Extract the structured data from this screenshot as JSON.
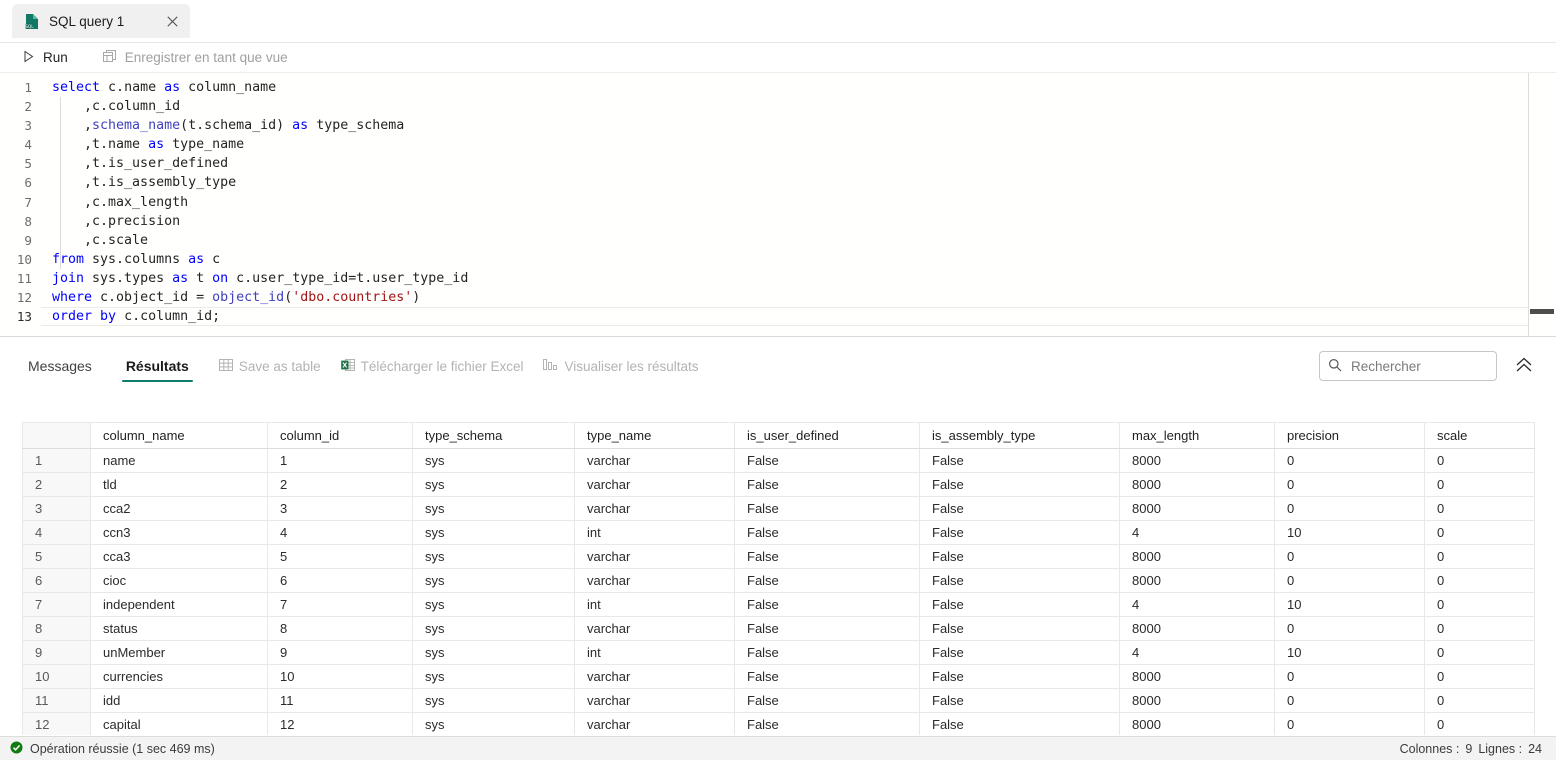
{
  "tab": {
    "title": "SQL query 1",
    "icon": "sql-file-icon",
    "close_icon": "close-icon"
  },
  "query_toolbar": {
    "run_label": "Run",
    "run_icon": "play-icon",
    "save_as_view_label": "Enregistrer en tant que vue",
    "save_as_view_icon": "save-view-icon"
  },
  "editor": {
    "lines": [
      {
        "n": "1",
        "html": "<span class=\"kw\">select</span> c.name <span class=\"kw\">as</span> column_name"
      },
      {
        "n": "2",
        "html": "    ,c.column_id"
      },
      {
        "n": "3",
        "html": "    ,<span class=\"fn\">schema_name</span>(t.schema_id) <span class=\"kw\">as</span> type_schema"
      },
      {
        "n": "4",
        "html": "    ,t.name <span class=\"kw\">as</span> type_name"
      },
      {
        "n": "5",
        "html": "    ,t.is_user_defined"
      },
      {
        "n": "6",
        "html": "    ,t.is_assembly_type"
      },
      {
        "n": "7",
        "html": "    ,c.max_length"
      },
      {
        "n": "8",
        "html": "    ,c.precision"
      },
      {
        "n": "9",
        "html": "    ,c.scale"
      },
      {
        "n": "10",
        "html": "<span class=\"kw\">from</span> sys.columns <span class=\"kw\">as</span> c"
      },
      {
        "n": "11",
        "html": "<span class=\"kw\">join</span> sys.types <span class=\"kw\">as</span> t <span class=\"kw\">on</span> c.user_type_id=t.user_type_id"
      },
      {
        "n": "12",
        "html": "<span class=\"kw\">where</span> c.object_id = <span class=\"fn\">object_id</span>(<span class=\"str\">'dbo.countries'</span>)"
      },
      {
        "n": "13",
        "html": "<span class=\"kw\">order</span> <span class=\"kw\">by</span> c.column_id;",
        "current": true
      }
    ],
    "plain_text": "select c.name as column_name\n    ,c.column_id\n    ,schema_name(t.schema_id) as type_schema\n    ,t.name as type_name\n    ,t.is_user_defined\n    ,t.is_assembly_type\n    ,c.max_length\n    ,c.precision\n    ,c.scale\nfrom sys.columns as c\njoin sys.types as t on c.user_type_id=t.user_type_id\nwhere c.object_id = object_id('dbo.countries')\norder by c.column_id;"
  },
  "results_toolbar": {
    "tabs": [
      {
        "label": "Messages",
        "active": false
      },
      {
        "label": "Résultats",
        "active": true
      }
    ],
    "actions": [
      {
        "label": "Save as table",
        "icon": "table-grid-icon",
        "enabled": false
      },
      {
        "label": "Télécharger le fichier Excel",
        "icon": "excel-icon",
        "enabled": false
      },
      {
        "label": "Visualiser les résultats",
        "icon": "bar-chart-icon",
        "enabled": false
      }
    ],
    "search": {
      "placeholder": "Rechercher",
      "value": "",
      "icon": "search-icon"
    },
    "collapse_icon": "double-chevron-up-icon",
    "active_tab_accent": "#107c6e"
  },
  "results_grid": {
    "columns": [
      "column_name",
      "column_id",
      "type_schema",
      "type_name",
      "is_user_defined",
      "is_assembly_type",
      "max_length",
      "precision",
      "scale"
    ],
    "rows": [
      {
        "num": "1",
        "cells": [
          "name",
          "1",
          "sys",
          "varchar",
          "False",
          "False",
          "8000",
          "0",
          "0"
        ]
      },
      {
        "num": "2",
        "cells": [
          "tld",
          "2",
          "sys",
          "varchar",
          "False",
          "False",
          "8000",
          "0",
          "0"
        ]
      },
      {
        "num": "3",
        "cells": [
          "cca2",
          "3",
          "sys",
          "varchar",
          "False",
          "False",
          "8000",
          "0",
          "0"
        ]
      },
      {
        "num": "4",
        "cells": [
          "ccn3",
          "4",
          "sys",
          "int",
          "False",
          "False",
          "4",
          "10",
          "0"
        ]
      },
      {
        "num": "5",
        "cells": [
          "cca3",
          "5",
          "sys",
          "varchar",
          "False",
          "False",
          "8000",
          "0",
          "0"
        ]
      },
      {
        "num": "6",
        "cells": [
          "cioc",
          "6",
          "sys",
          "varchar",
          "False",
          "False",
          "8000",
          "0",
          "0"
        ]
      },
      {
        "num": "7",
        "cells": [
          "independent",
          "7",
          "sys",
          "int",
          "False",
          "False",
          "4",
          "10",
          "0"
        ]
      },
      {
        "num": "8",
        "cells": [
          "status",
          "8",
          "sys",
          "varchar",
          "False",
          "False",
          "8000",
          "0",
          "0"
        ]
      },
      {
        "num": "9",
        "cells": [
          "unMember",
          "9",
          "sys",
          "int",
          "False",
          "False",
          "4",
          "10",
          "0"
        ]
      },
      {
        "num": "10",
        "cells": [
          "currencies",
          "10",
          "sys",
          "varchar",
          "False",
          "False",
          "8000",
          "0",
          "0"
        ]
      },
      {
        "num": "11",
        "cells": [
          "idd",
          "11",
          "sys",
          "varchar",
          "False",
          "False",
          "8000",
          "0",
          "0"
        ]
      },
      {
        "num": "12",
        "cells": [
          "capital",
          "12",
          "sys",
          "varchar",
          "False",
          "False",
          "8000",
          "0",
          "0"
        ]
      }
    ]
  },
  "statusbar": {
    "status_icon": "success-check-icon",
    "status_color": "#107c10",
    "message": "Opération réussie (1 sec 469 ms)",
    "columns_label": "Colonnes :",
    "columns_value": "9",
    "rows_label": "Lignes :",
    "rows_value": "24"
  }
}
